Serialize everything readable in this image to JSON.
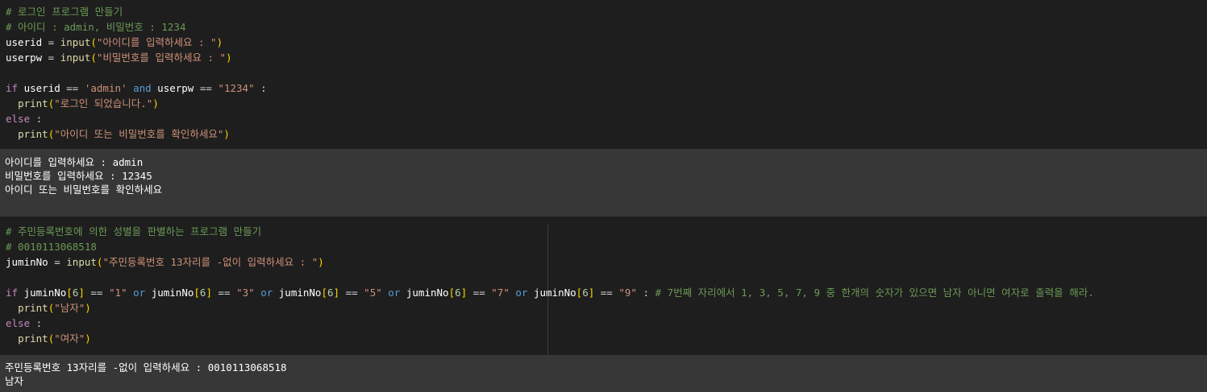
{
  "cell1": {
    "code": {
      "comment1": "# 로그인 프로그램 만들기",
      "comment2": "# 아이디 : admin, 비밀번호 : 1234",
      "l3_var": "userid",
      "l3_eq": " = ",
      "l3_func": "input",
      "l3_str": "\"아이디를 입력하세요 : \"",
      "l4_var": "userpw",
      "l4_eq": " = ",
      "l4_func": "input",
      "l4_str": "\"비밀번호를 입력하세요 : \"",
      "if_kw": "if",
      "if_var1": " userid ",
      "if_eqeq1": "== ",
      "if_str1": "'admin'",
      "if_and": "and",
      "if_var2": " userpw ",
      "if_eqeq2": "== ",
      "if_str2": "\"1234\"",
      "if_colon": " :",
      "print_func": "print",
      "print1_str": "\"로그인 되었습니다.\"",
      "else_kw": "else",
      "else_colon": " :",
      "print2_str": "\"아이디 또는 비밀번호를 확인하세요\""
    },
    "output": [
      "아이디를 입력하세요 : admin",
      "비밀번호를 입력하세요 : 12345",
      "아이디 또는 비밀번호를 확인하세요"
    ]
  },
  "cell2": {
    "code": {
      "comment1": "# 주민등록번호에 의한 성별을 판별하는 프로그램 만들기",
      "comment2": "# 0010113068518",
      "l3_var": "juminNo",
      "l3_eq": " = ",
      "l3_func": "input",
      "l3_str": "\"주민등록번호 13자리를 -없이 입력하세요 : \"",
      "if_kw": "if",
      "var": "juminNo",
      "idx": "6",
      "eqeq": " == ",
      "or": "or",
      "s1": "\"1\"",
      "s3": "\"3\"",
      "s5": "\"5\"",
      "s7": "\"7\"",
      "s9": "\"9\"",
      "colon": " : ",
      "trail_comment": "# 7번째 자리에서 1, 3, 5, 7, 9 중 한개의 숫자가 있으면 남자 아니면 여자로 출력을 해라.",
      "print_func": "print",
      "print1_str": "\"남자\"",
      "else_kw": "else",
      "else_colon": " :",
      "print2_str": "\"여자\""
    },
    "output": [
      "주민등록번호 13자리를 -없이 입력하세요 : 0010113068518",
      "남자"
    ]
  }
}
